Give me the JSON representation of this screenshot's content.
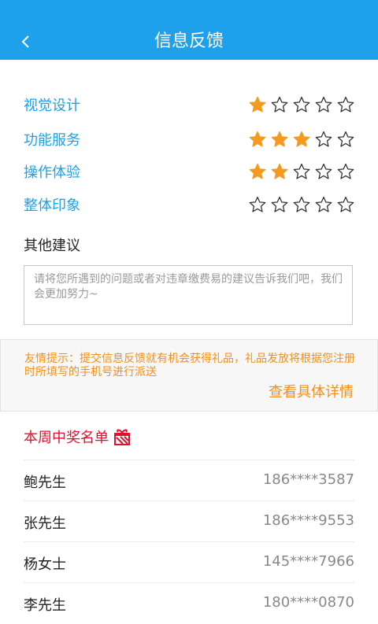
{
  "header": {
    "title": "信息反馈"
  },
  "ratings": [
    {
      "label": "视觉设计",
      "score": 1,
      "max": 5
    },
    {
      "label": "功能服务",
      "score": 3,
      "max": 5
    },
    {
      "label": "操作体验",
      "score": 2,
      "max": 5
    },
    {
      "label": "整体印象",
      "score": 0,
      "max": 5
    }
  ],
  "suggestion": {
    "title": "其他建议",
    "placeholder": "请将您所遇到的问题或者对违章缴费易的建议告诉我们吧，我们会更加努力~"
  },
  "tip": {
    "text": "友情提示：提交信息反馈就有机会获得礼品，礼品发放将根据您注册时所填写的手机号进行派送",
    "link": "查看具体详情"
  },
  "winners": {
    "title": "本周中奖名单",
    "list": [
      {
        "name": "鲍先生",
        "phone": "186****3587"
      },
      {
        "name": "张先生",
        "phone": "186****9553"
      },
      {
        "name": "杨女士",
        "phone": "145****7966"
      },
      {
        "name": "李先生",
        "phone": "180****0870"
      }
    ]
  },
  "colors": {
    "header": "#1ea0ea",
    "star_filled": "#f59a1f",
    "star_empty": "#333333",
    "tip": "#f0901e",
    "winners_title": "#e0112b"
  },
  "icons": {
    "back": "chevron-left-icon",
    "star": "star-icon",
    "gift": "gift-icon"
  }
}
